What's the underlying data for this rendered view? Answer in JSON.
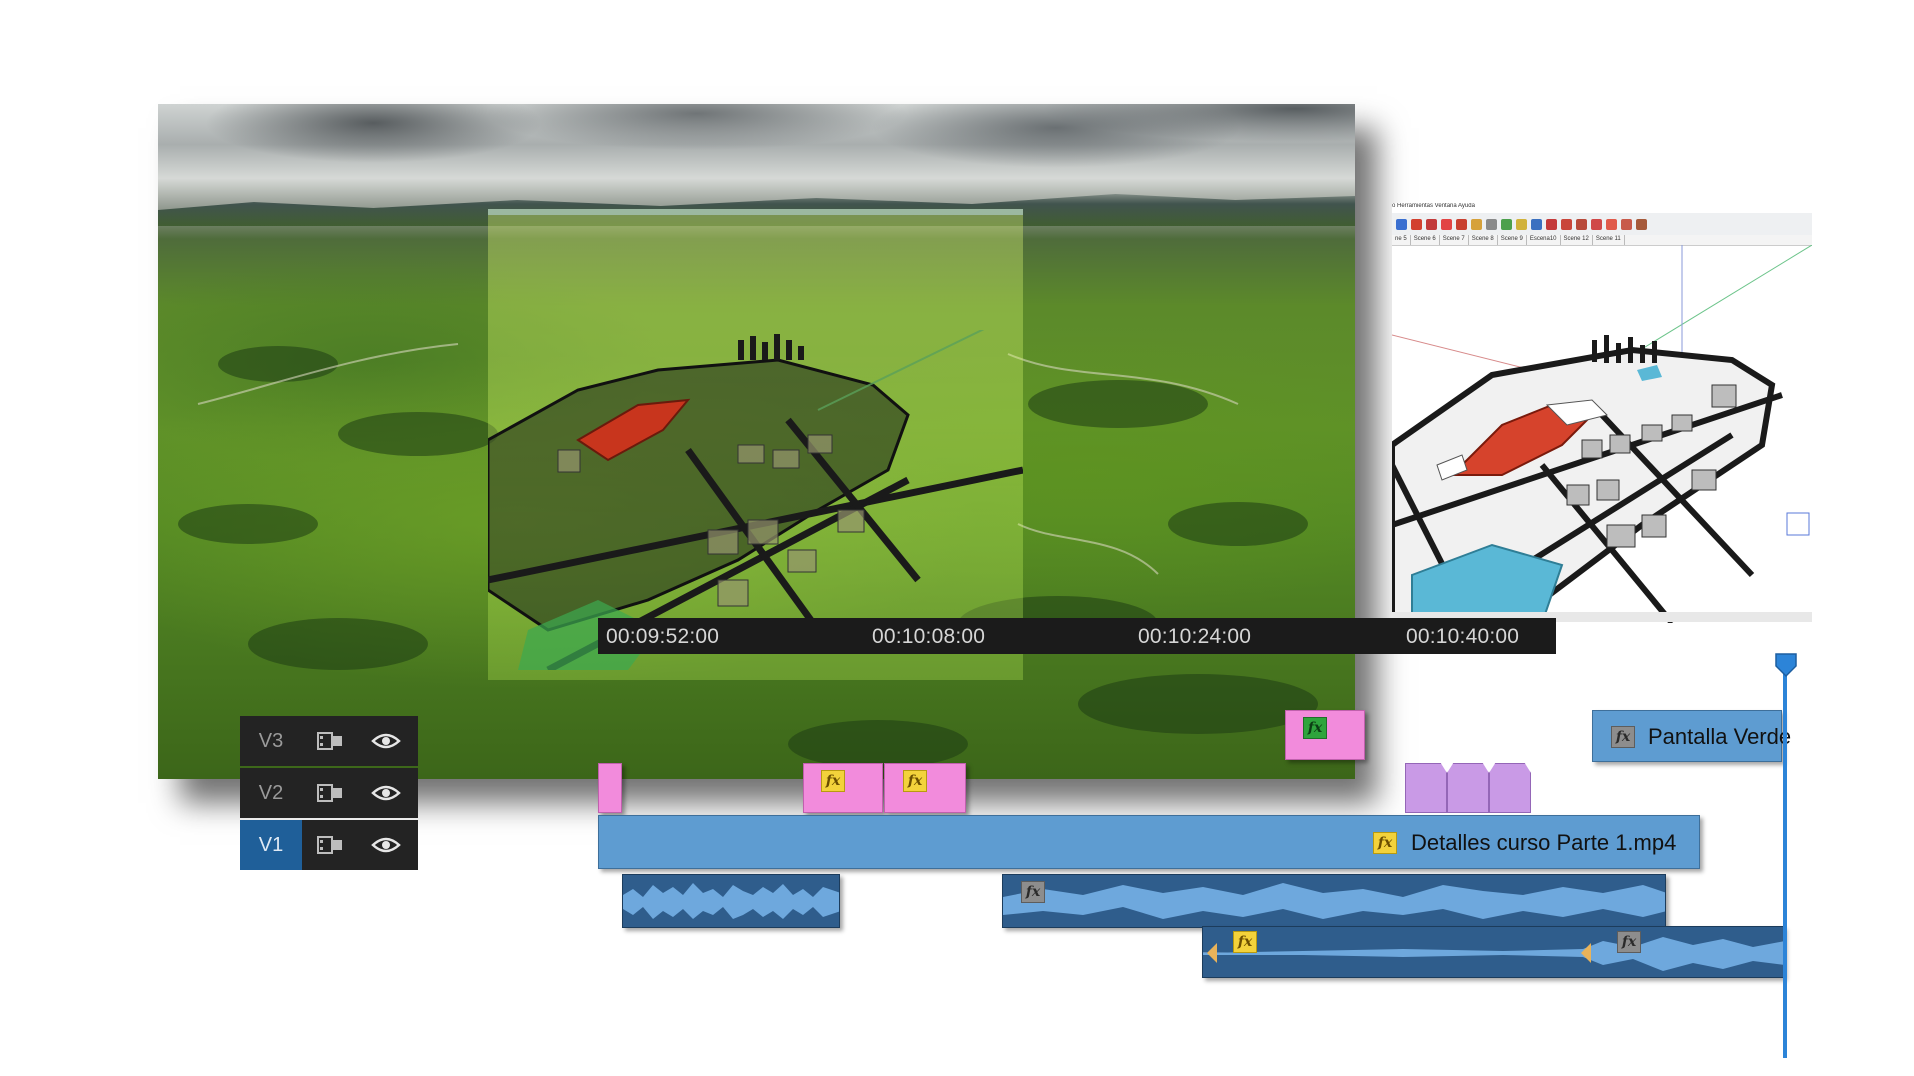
{
  "timeline": {
    "timecodes": [
      "00:09:52:00",
      "00:10:08:00",
      "00:10:24:00",
      "00:10:40:00"
    ]
  },
  "tracks": [
    {
      "label": "V3",
      "active": false
    },
    {
      "label": "V2",
      "active": false
    },
    {
      "label": "V1",
      "active": true
    }
  ],
  "clips": {
    "v3_clip_name": "Pantalla Verde",
    "v1_clip_name": "Detalles curso Parte 1.mp4",
    "fx_label": "fx"
  },
  "sketchup": {
    "menu": "o   Herramientas   Ventana   Ayuda",
    "scenes": [
      "ne 5",
      "Scene 6",
      "Scene 7",
      "Scene 8",
      "Scene 9",
      "Escena10",
      "Scene 12",
      "Scene 11"
    ]
  },
  "colors": {
    "video_clip": "#5e9cd1",
    "effect_clip": "#f28bdc",
    "transition_clip": "#c99ae6",
    "audio_clip": "#2f5d8c",
    "active_track": "#1f5f99",
    "playhead": "#2c84d8"
  },
  "icons": {
    "track_output": "film-strip-icon",
    "track_visibility": "eye-icon",
    "effect_badge": "fx-icon",
    "playhead": "playhead-marker-icon"
  }
}
